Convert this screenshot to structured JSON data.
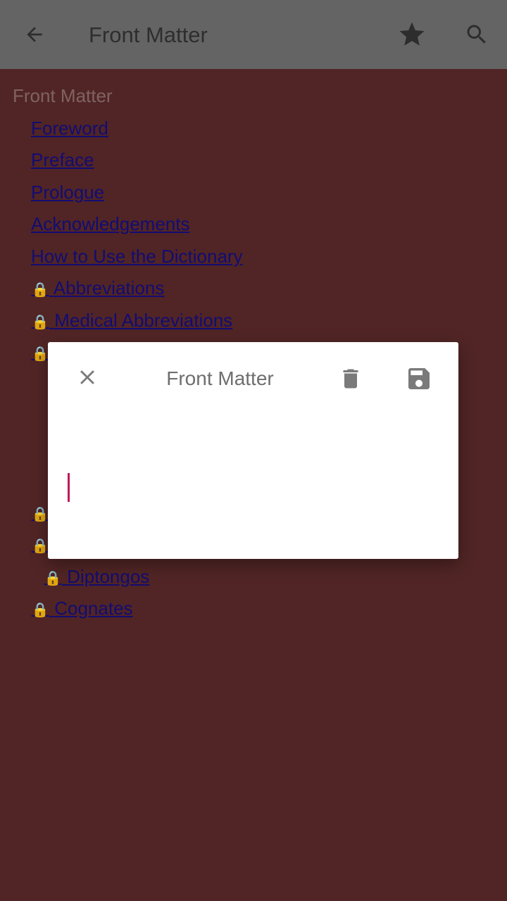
{
  "appbar": {
    "title": "Front Matter",
    "icons": {
      "back": "arrow-back-icon",
      "star": "star-icon",
      "search": "search-icon"
    }
  },
  "content": {
    "section_title": "Front Matter",
    "items": [
      {
        "label": "Foreword",
        "locked": false
      },
      {
        "label": "Preface",
        "locked": false
      },
      {
        "label": "Prologue",
        "locked": false
      },
      {
        "label": "Acknowledgements",
        "locked": false
      },
      {
        "label": "How to Use the Dictionary",
        "locked": false
      },
      {
        "label": "Abbreviations",
        "locked": true
      },
      {
        "label": "Medical Abbreviations",
        "locked": true
      },
      {
        "label": "Diptongos",
        "locked": true
      },
      {
        "label": "Cognates",
        "locked": true
      }
    ],
    "lock_glyph": "🔒"
  },
  "dialog": {
    "title": "Front Matter",
    "input_value": "",
    "icons": {
      "close": "close-icon",
      "delete": "trash-icon",
      "save": "save-icon"
    },
    "caret_color": "#c2185b"
  }
}
